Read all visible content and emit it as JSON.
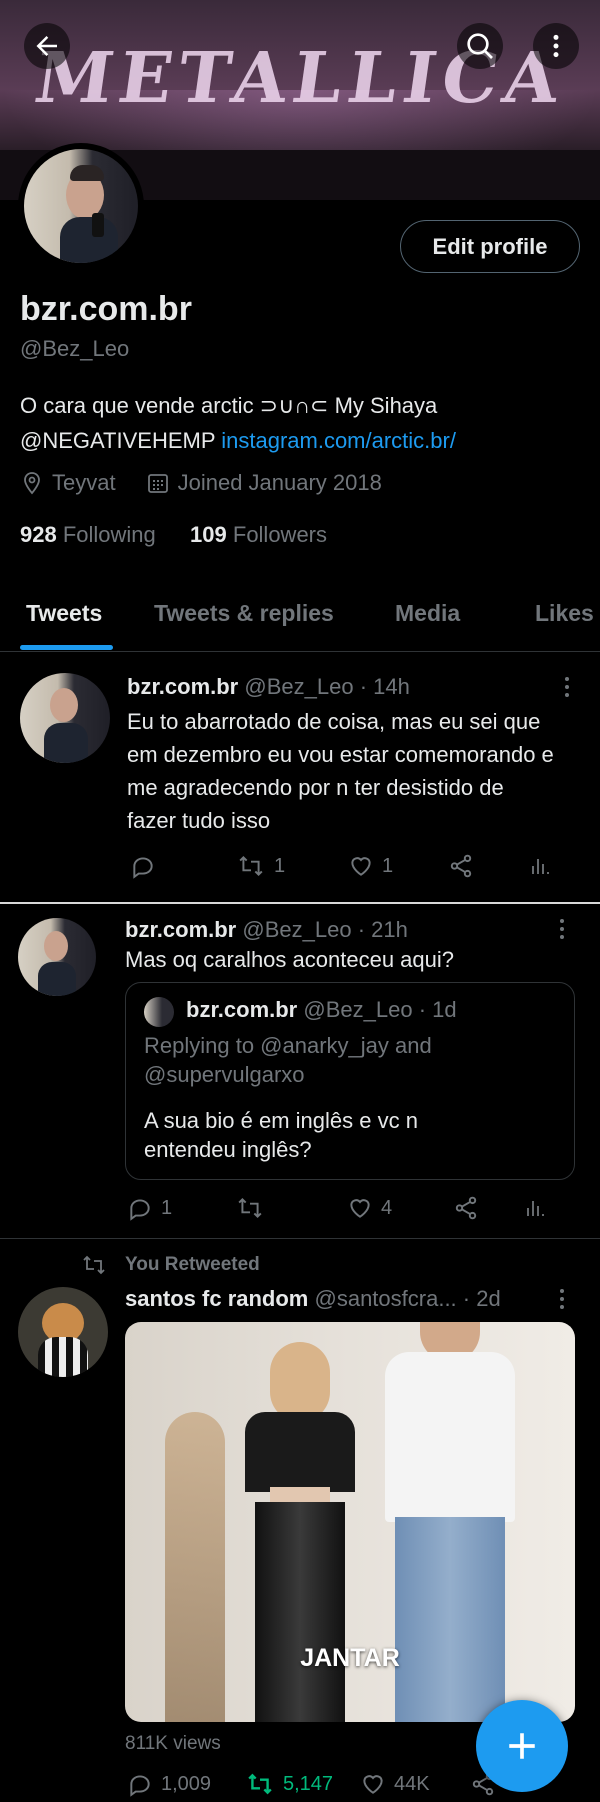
{
  "banner": {
    "text": "METALLICA"
  },
  "profile": {
    "edit_label": "Edit profile",
    "name": "bzr.com.br",
    "handle": "@Bez_Leo",
    "bio_text": "O cara que vende arctic ⊃∪∩⊂ My Sihaya @NEGATIVEHEMP ",
    "bio_link": "instagram.com/arctic.br/",
    "location": "Teyvat",
    "joined": "Joined January 2018",
    "following_count": "928",
    "following_label": "Following",
    "followers_count": "109",
    "followers_label": "Followers"
  },
  "tabs": [
    {
      "label": "Tweets"
    },
    {
      "label": "Tweets & replies"
    },
    {
      "label": "Media"
    },
    {
      "label": "Likes"
    }
  ],
  "tweets": [
    {
      "name": "bzr.com.br",
      "handle": "@Bez_Leo",
      "time": "· 14h",
      "text": "Eu to abarrotado de coisa, mas eu sei que em dezembro eu vou estar comemorando e me agradecendo por n ter desistido de fazer tudo isso",
      "replies": "",
      "retweets": "1",
      "likes": "1"
    },
    {
      "name": "bzr.com.br",
      "handle": "@Bez_Leo",
      "time": "· 21h",
      "text": "Mas oq caralhos aconteceu aqui?",
      "quote": {
        "name": "bzr.com.br",
        "handle": "@Bez_Leo",
        "time": "· 1d",
        "replying": "Replying to @anarky_jay and @supervulgarxo",
        "text": "A sua bio é em inglês e vc n entendeu inglês?"
      },
      "replies": "1",
      "retweets": "",
      "likes": "4"
    },
    {
      "retweeted_label": "You Retweeted",
      "name": "santos fc random",
      "handle": "@santosfcra...",
      "time": "· 2d",
      "media_caption": "JANTAR",
      "views": "811K views",
      "replies": "1,009",
      "retweets": "5,147",
      "likes": "44K"
    }
  ],
  "colors": {
    "accent": "#1d9bf0",
    "retweet_active": "#00ba7c",
    "muted": "#71767b"
  }
}
